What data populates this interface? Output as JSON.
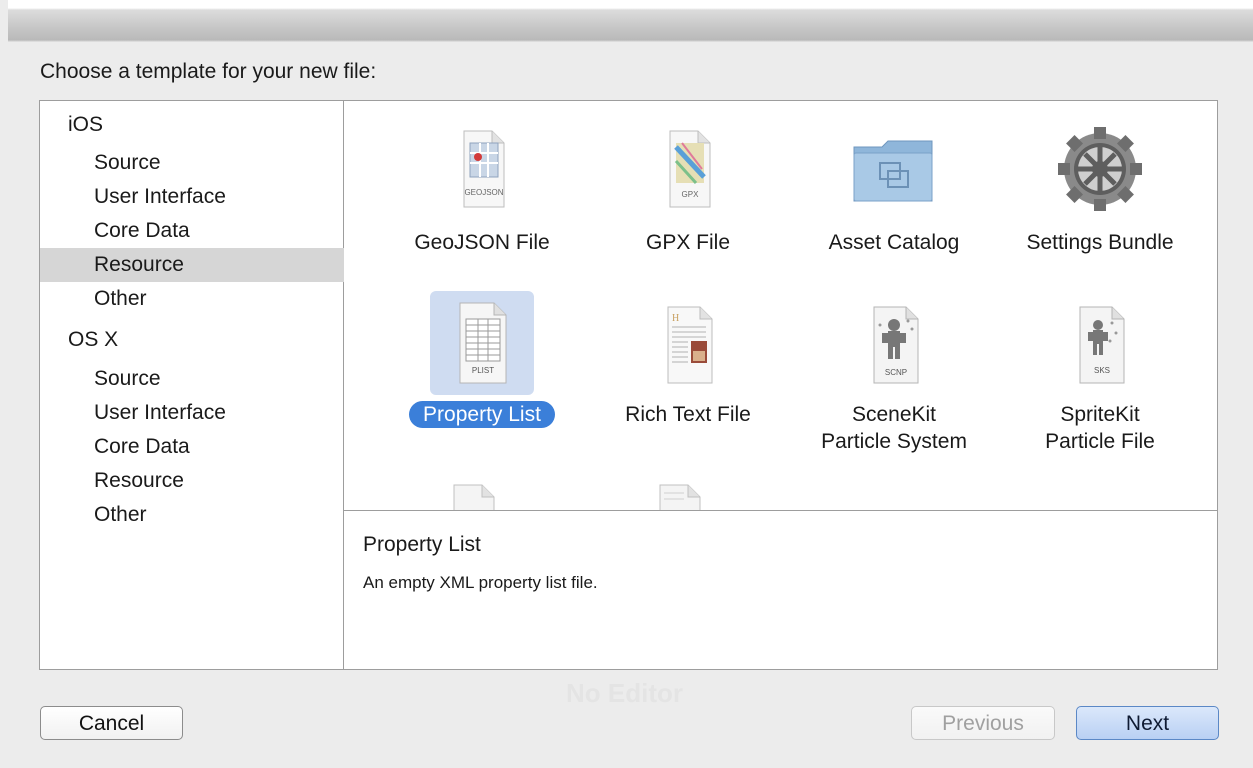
{
  "dialog": {
    "prompt": "Choose a template for your new file:"
  },
  "sidebar": {
    "items": [
      {
        "label": "iOS",
        "level": "header"
      },
      {
        "label": "Source",
        "level": "child"
      },
      {
        "label": "User Interface",
        "level": "child"
      },
      {
        "label": "Core Data",
        "level": "child"
      },
      {
        "label": "Resource",
        "level": "child",
        "selected": true
      },
      {
        "label": "Other",
        "level": "child"
      },
      {
        "label": "OS X",
        "level": "header"
      },
      {
        "label": "Source",
        "level": "child"
      },
      {
        "label": "User Interface",
        "level": "child"
      },
      {
        "label": "Core Data",
        "level": "child"
      },
      {
        "label": "Resource",
        "level": "child"
      },
      {
        "label": "Other",
        "level": "child"
      }
    ]
  },
  "templates": [
    {
      "line1": "GeoJSON File",
      "line2": "",
      "icon": "geojson-file-icon",
      "badge": "GEOJSON"
    },
    {
      "line1": "GPX File",
      "line2": "",
      "icon": "gpx-file-icon",
      "badge": "GPX"
    },
    {
      "line1": "Asset Catalog",
      "line2": "",
      "icon": "asset-catalog-folder-icon",
      "badge": ""
    },
    {
      "line1": "Settings Bundle",
      "line2": "",
      "icon": "settings-gear-icon",
      "badge": ""
    },
    {
      "line1": "Property List",
      "line2": "",
      "icon": "plist-file-icon",
      "badge": "PLIST",
      "selected": true
    },
    {
      "line1": "Rich Text File",
      "line2": "",
      "icon": "rich-text-file-icon",
      "badge": ""
    },
    {
      "line1": "SceneKit",
      "line2": "Particle System",
      "icon": "scenekit-particle-icon",
      "badge": "SCNP"
    },
    {
      "line1": "SpriteKit",
      "line2": "Particle File",
      "icon": "spritekit-particle-icon",
      "badge": "SKS"
    }
  ],
  "description": {
    "title": "Property List",
    "body": "An empty XML property list file."
  },
  "ghost_text": "No Editor",
  "buttons": {
    "cancel": "Cancel",
    "previous": "Previous",
    "next": "Next"
  },
  "colors": {
    "selection_blue": "#3b7fd9",
    "selection_tile_bg": "#cfdcf1",
    "sidebar_selected_bg": "#d6d6d6"
  }
}
